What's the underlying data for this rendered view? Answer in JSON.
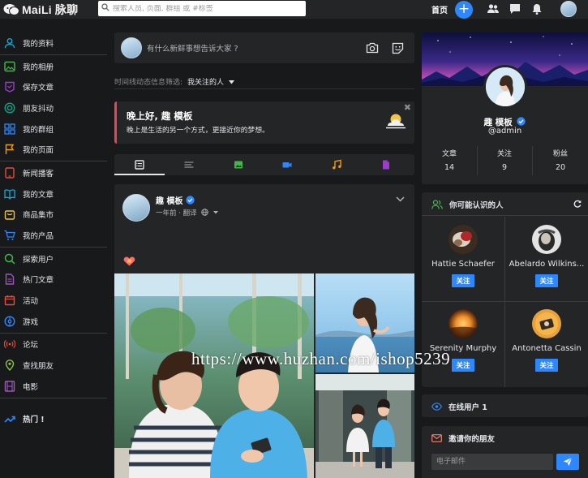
{
  "brand": {
    "logo_text": "MaiLi 脉聊"
  },
  "search": {
    "placeholder": "搜索人员, 页面, 群组 或 #标签"
  },
  "nav": {
    "home_label": "首页",
    "plus_label": "+"
  },
  "sidebar": {
    "items": [
      {
        "label": "我的资料",
        "icon": "user-icon",
        "color": "#1aa6d0"
      },
      {
        "label": "我的相册",
        "icon": "image-icon",
        "color": "#43b74a"
      },
      {
        "label": "保存文章",
        "icon": "bookmark-icon",
        "color": "#9c3ccb"
      },
      {
        "label": "朋友抖动",
        "icon": "poke-icon",
        "color": "#16a085"
      },
      {
        "label": "我的群组",
        "icon": "group-icon",
        "color": "#2d88ff"
      },
      {
        "label": "我的页面",
        "icon": "flag-icon",
        "color": "#f39c12"
      },
      {
        "label": "新闻播客",
        "icon": "tablet-icon",
        "color": "#e74c3c"
      },
      {
        "label": "我的文章",
        "icon": "book-icon",
        "color": "#1aa6d0"
      },
      {
        "label": "商品集市",
        "icon": "bag-icon",
        "color": "#e8c547"
      },
      {
        "label": "我的产品",
        "icon": "cart-icon",
        "color": "#2d88ff"
      },
      {
        "label": "探索用户",
        "icon": "search-icon",
        "color": "#43b74a"
      },
      {
        "label": "热门文章",
        "icon": "document-icon",
        "color": "#9b59b6"
      },
      {
        "label": "活动",
        "icon": "calendar-icon",
        "color": "#e74c3c"
      },
      {
        "label": "游戏",
        "icon": "gamepad-icon",
        "color": "#2d88ff"
      },
      {
        "label": "论坛",
        "icon": "broadcast-icon",
        "color": "#e74c3c"
      },
      {
        "label": "查找朋友",
        "icon": "location-icon",
        "color": "#8bc34a"
      },
      {
        "label": "电影",
        "icon": "film-icon",
        "color": "#9b59b6"
      }
    ],
    "hot_label": "热门 !"
  },
  "composer": {
    "placeholder": "有什么新鲜事想告诉大家 ?"
  },
  "filter": {
    "label": "时间线动态信息筛选:",
    "value": "我关注的人"
  },
  "greeting": {
    "title": "晚上好, 趣 模板",
    "subtitle": "晚上是生活的另一个方式，更接近你的梦想。",
    "close": "✖"
  },
  "post": {
    "author": "趣 模板",
    "meta": "一年前 · 翻译"
  },
  "profile": {
    "name": "趣 模板",
    "handle": "@admin",
    "stats": [
      {
        "label": "文章",
        "value": "14"
      },
      {
        "label": "关注",
        "value": "9"
      },
      {
        "label": "粉丝",
        "value": "20"
      }
    ]
  },
  "suggestions": {
    "title": "你可能认识的人",
    "follow_label": "关注",
    "people": [
      {
        "name": "Hattie Schaefer"
      },
      {
        "name": "Abelardo Wilkins..."
      },
      {
        "name": "Serenity Murphy"
      },
      {
        "name": "Antonetta Cassin"
      }
    ]
  },
  "online": {
    "title": "在线用户 1"
  },
  "invite": {
    "title": "邀请你的朋友",
    "email_placeholder": "电子邮件"
  },
  "watermark": "https://www.huzhan.com/ishop5239"
}
